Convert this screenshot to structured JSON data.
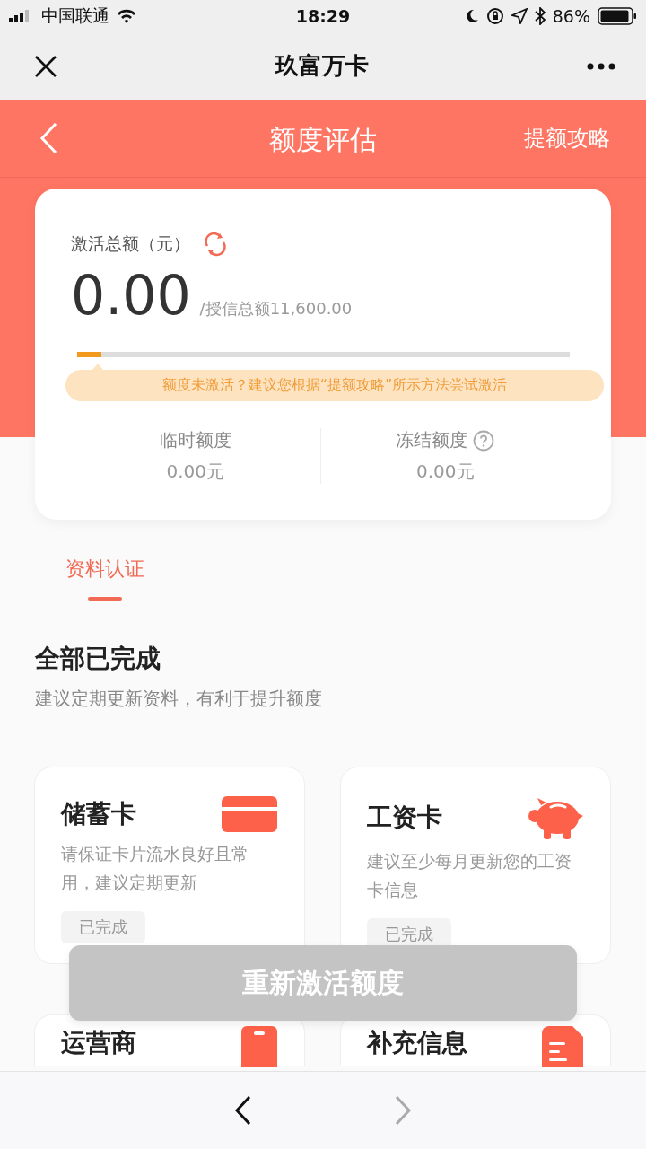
{
  "status_bar": {
    "carrier": "中国联通",
    "time": "18:29",
    "battery": "86%"
  },
  "nav_bar": {
    "title": "玖富万卡"
  },
  "header": {
    "title": "额度评估",
    "link": "提额攻略"
  },
  "summary": {
    "label": "激活总额（元）",
    "amount": "0.00",
    "total": "/授信总额11,600.00",
    "level": 0.05,
    "tip": "额度未激活？建议您根据“提额攻略”所示方法尝试激活",
    "stats": [
      {
        "label": "临时额度",
        "value": "0.00元",
        "help": false
      },
      {
        "label": "冻结额度",
        "value": "0.00元",
        "help": true
      }
    ]
  },
  "tabs": [
    {
      "label": "资料认证",
      "selected": true
    }
  ],
  "section": {
    "title": "全部已完成",
    "subtitle": "建议定期更新资料，有利于提升额度"
  },
  "items": [
    {
      "title": "储蓄卡",
      "kind": "card",
      "description": "请保证卡片流水良好且常用，建议定期更新",
      "status": "已完成"
    },
    {
      "title": "工资卡",
      "kind": "piggy",
      "description": "建议至少每月更新您的工资卡信息",
      "status": "已完成"
    },
    {
      "title": "运营商",
      "kind": "phone"
    },
    {
      "title": "补充信息",
      "kind": "doc"
    }
  ],
  "action_button": {
    "label": "重新激活额度",
    "disabled": true
  },
  "toolbar": {
    "back_disabled": false,
    "forward_disabled": true
  }
}
